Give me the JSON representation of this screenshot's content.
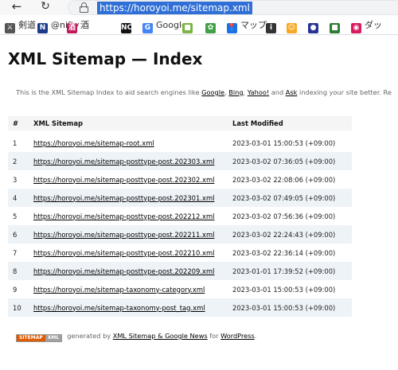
{
  "browser": {
    "url": "https://horoyoi.me/sitemap.xml",
    "bookmarks": [
      {
        "label": "剣道",
        "icon": "sword-icon",
        "color": "#555555"
      },
      {
        "label": "@nifty",
        "icon": "nifty-icon",
        "color": "#1d3a8a"
      },
      {
        "label": "酒",
        "icon": "sake-icon",
        "color": "#c2185b"
      },
      {
        "label": "",
        "icon": "nc-icon",
        "color": "#111111"
      },
      {
        "label": "Google",
        "icon": "google-icon",
        "color": "#4285f4"
      },
      {
        "label": "",
        "icon": "green-square-icon",
        "color": "#7cb342"
      },
      {
        "label": "",
        "icon": "plant-icon",
        "color": "#43a047"
      },
      {
        "label": "マップ",
        "icon": "map-pin-icon",
        "color": "#1a73e8"
      },
      {
        "label": "",
        "icon": "circle-i-icon",
        "color": "#333333"
      },
      {
        "label": "",
        "icon": "smile-icon",
        "color": "#f9a825"
      },
      {
        "label": "",
        "icon": "blue-circle-icon",
        "color": "#283593"
      },
      {
        "label": "",
        "icon": "green-bookmark-icon",
        "color": "#2e7d32"
      },
      {
        "label": "ダッ",
        "icon": "pink-icon",
        "color": "#d81b60"
      }
    ]
  },
  "page": {
    "title": "XML Sitemap — Index",
    "intro_prefix": "This is the XML Sitemap Index to aid search engines like ",
    "intro_links": [
      "Google",
      "Bing",
      "Yahoo!",
      "Ask"
    ],
    "intro_suffix": " indexing your site better. Re",
    "table": {
      "headers": [
        "#",
        "XML Sitemap",
        "Last Modified"
      ],
      "rows": [
        {
          "num": "1",
          "url": "https://horoyoi.me/sitemap-root.xml",
          "modified": "2023-03-01 15:00:53 (+09:00)"
        },
        {
          "num": "2",
          "url": "https://horoyoi.me/sitemap-posttype-post.202303.xml",
          "modified": "2023-03-02 07:36:05 (+09:00)"
        },
        {
          "num": "3",
          "url": "https://horoyoi.me/sitemap-posttype-post.202302.xml",
          "modified": "2023-03-02 22:08:06 (+09:00)"
        },
        {
          "num": "4",
          "url": "https://horoyoi.me/sitemap-posttype-post.202301.xml",
          "modified": "2023-03-02 07:49:05 (+09:00)"
        },
        {
          "num": "5",
          "url": "https://horoyoi.me/sitemap-posttype-post.202212.xml",
          "modified": "2023-03-02 07:56:36 (+09:00)"
        },
        {
          "num": "6",
          "url": "https://horoyoi.me/sitemap-posttype-post.202211.xml",
          "modified": "2023-03-02 22:24:43 (+09:00)"
        },
        {
          "num": "7",
          "url": "https://horoyoi.me/sitemap-posttype-post.202210.xml",
          "modified": "2023-03-02 22:36:14 (+09:00)"
        },
        {
          "num": "8",
          "url": "https://horoyoi.me/sitemap-posttype-post.202209.xml",
          "modified": "2023-01-01 17:39:52 (+09:00)"
        },
        {
          "num": "9",
          "url": "https://horoyoi.me/sitemap-taxonomy-category.xml",
          "modified": "2023-03-01 15:00:53 (+09:00)"
        },
        {
          "num": "10",
          "url": "https://horoyoi.me/sitemap-taxonomy-post_tag.xml",
          "modified": "2023-03-01 15:00:53 (+09:00)"
        }
      ]
    },
    "footer": {
      "badge_left": "SITEMAP",
      "badge_right": "XML",
      "text1": "generated by ",
      "link1": "XML Sitemap & Google News",
      "text2": " for ",
      "link2": "WordPress",
      "text3": "."
    }
  }
}
